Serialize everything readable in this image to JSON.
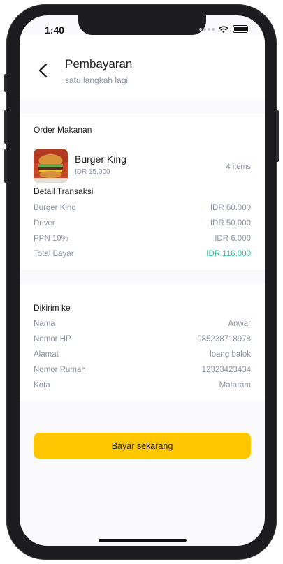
{
  "status": {
    "time": "1:40"
  },
  "header": {
    "title": "Pembayaran",
    "subtitle": "satu langkah lagi"
  },
  "order": {
    "section_label": "Order Makanan",
    "item": {
      "name": "Burger King",
      "price": "IDR 15.000",
      "count": "4 items"
    }
  },
  "transaction": {
    "section_label": "Detail Transaksi",
    "rows": [
      {
        "label": "Burger King",
        "value": "IDR 60.000"
      },
      {
        "label": "Driver",
        "value": "IDR 50.000"
      },
      {
        "label": "PPN 10%",
        "value": "IDR 6.000"
      },
      {
        "label": "Total Bayar",
        "value": "IDR 116.000"
      }
    ]
  },
  "delivery": {
    "section_label": "Dikirim ke",
    "rows": [
      {
        "label": "Nama",
        "value": "Anwar"
      },
      {
        "label": "Nomor HP",
        "value": "085238718978"
      },
      {
        "label": "Alamat",
        "value": "loang balok"
      },
      {
        "label": "Nomor Rumah",
        "value": "12323423434"
      },
      {
        "label": "Kota",
        "value": "Mataram"
      }
    ]
  },
  "actions": {
    "pay_label": "Bayar sekarang"
  },
  "colors": {
    "accent": "#ffc700",
    "total": "#1abc9c",
    "muted": "#8d92a3"
  }
}
